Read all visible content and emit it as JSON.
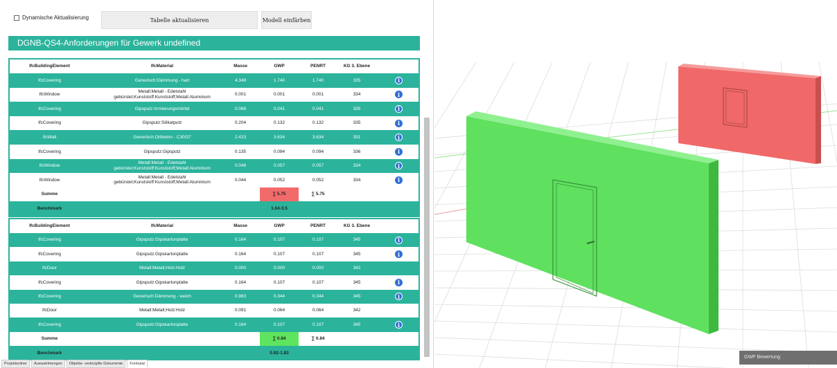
{
  "toolbar": {
    "dynamic_update_label": "Dynamische Aktualisierung",
    "refresh_button_label": "Tabelle aktualisieren",
    "color_button_label": "Modell einfärben"
  },
  "title": "DGNB-QS4-Anforderungen für Gewerk undefined",
  "columns": [
    "IfcBuildingElement",
    "IfcMaterial",
    "Masse",
    "GWP",
    "PENRT",
    "KG 3. Ebene"
  ],
  "table1": {
    "rows": [
      {
        "element": "IfcCovering",
        "material": "Generisch:Dämmung - hart",
        "masse": "4.349",
        "gwp": "1.740",
        "penrt": "1.740",
        "kg": "335",
        "info": true
      },
      {
        "element": "IfcWindow",
        "material": "Metall:Metall - Edelstahl gebürstet;Kunststoff:Kunststoff;Metall:Aluminium",
        "masse": "0.001",
        "gwp": "0.001",
        "penrt": "0.001",
        "kg": "334",
        "info": true
      },
      {
        "element": "IfcCovering",
        "material": "Gipsputz:Armierungsmörtel",
        "masse": "0.068",
        "gwp": "0.041",
        "penrt": "0.041",
        "kg": "335",
        "info": true
      },
      {
        "element": "IfcCovering",
        "material": "Gipsputz:Silikatputz",
        "masse": "0.204",
        "gwp": "0.132",
        "penrt": "0.132",
        "kg": "335",
        "info": true
      },
      {
        "element": "IfcWall",
        "material": "Generisch:Ortbeton - C30/37",
        "masse": "2.423",
        "gwp": "3.634",
        "penrt": "3.634",
        "kg": "331",
        "info": true
      },
      {
        "element": "IfcCovering",
        "material": "Gipsputz:Gipsputz",
        "masse": "0.135",
        "gwp": "0.094",
        "penrt": "0.094",
        "kg": "336",
        "info": true
      },
      {
        "element": "IfcWindow",
        "material": "Metall:Metall - Edelstahl gebürstet;Kunststoff:Kunststoff;Metall:Aluminium",
        "masse": "0.048",
        "gwp": "0.057",
        "penrt": "0.057",
        "kg": "334",
        "info": true
      },
      {
        "element": "IfcWindow",
        "material": "Metall:Metall - Edelstahl gebürstet;Kunststoff:Kunststoff;Metall:Aluminium",
        "masse": "0.044",
        "gwp": "0.052",
        "penrt": "0.052",
        "kg": "334",
        "info": true
      }
    ],
    "sum_label": "Summe",
    "sum_gwp": "∑ 5.75",
    "sum_penrt": "∑ 5.75",
    "sum_gwp_color": "#f26b6b",
    "benchmark_label": "Benchmark",
    "benchmark_value": "1.64-3.5"
  },
  "table2": {
    "rows": [
      {
        "element": "IfcCovering",
        "material": "Gipsputz:Gipskartonplatte",
        "masse": "0.164",
        "gwp": "0.107",
        "penrt": "0.107",
        "kg": "345",
        "info": true
      },
      {
        "element": "IfcCovering",
        "material": "Gipsputz:Gipskartonplatte",
        "masse": "0.164",
        "gwp": "0.107",
        "penrt": "0.107",
        "kg": "345",
        "info": true
      },
      {
        "element": "IfcDoor",
        "material": "Metall:Metall;Holz:Holz",
        "masse": "0.000",
        "gwp": "0.000",
        "penrt": "0.000",
        "kg": "342",
        "info": false
      },
      {
        "element": "IfcCovering",
        "material": "Gipsputz:Gipskartonplatte",
        "masse": "0.164",
        "gwp": "0.107",
        "penrt": "0.107",
        "kg": "345",
        "info": true
      },
      {
        "element": "IfcCovering",
        "material": "Generisch:Dämmung - weich",
        "masse": "0.983",
        "gwp": "0.344",
        "penrt": "0.344",
        "kg": "345",
        "info": true
      },
      {
        "element": "IfcDoor",
        "material": "Metall:Metall;Holz:Holz",
        "masse": "0.091",
        "gwp": "0.064",
        "penrt": "0.064",
        "kg": "342",
        "info": false
      },
      {
        "element": "IfcCovering",
        "material": "Gipsputz:Gipskartonplatte",
        "masse": "0.164",
        "gwp": "0.107",
        "penrt": "0.107",
        "kg": "345",
        "info": true
      }
    ],
    "sum_label": "Summe",
    "sum_gwp": "∑ 0.84",
    "sum_penrt": "∑ 0.84",
    "sum_gwp_color": "#5fe45f",
    "benchmark_label": "Benchmark",
    "benchmark_value": "0.92-1.83"
  },
  "tabs": [
    "Projektordner",
    "Auswahlmengen",
    "Objekte- verknüpfte Dokumente",
    "Formular"
  ],
  "active_tab": 3,
  "viewer": {
    "gwp_label": "GWP Bewertung",
    "wall_green_color": "#5fe05f",
    "wall_red_color": "#f06868"
  }
}
